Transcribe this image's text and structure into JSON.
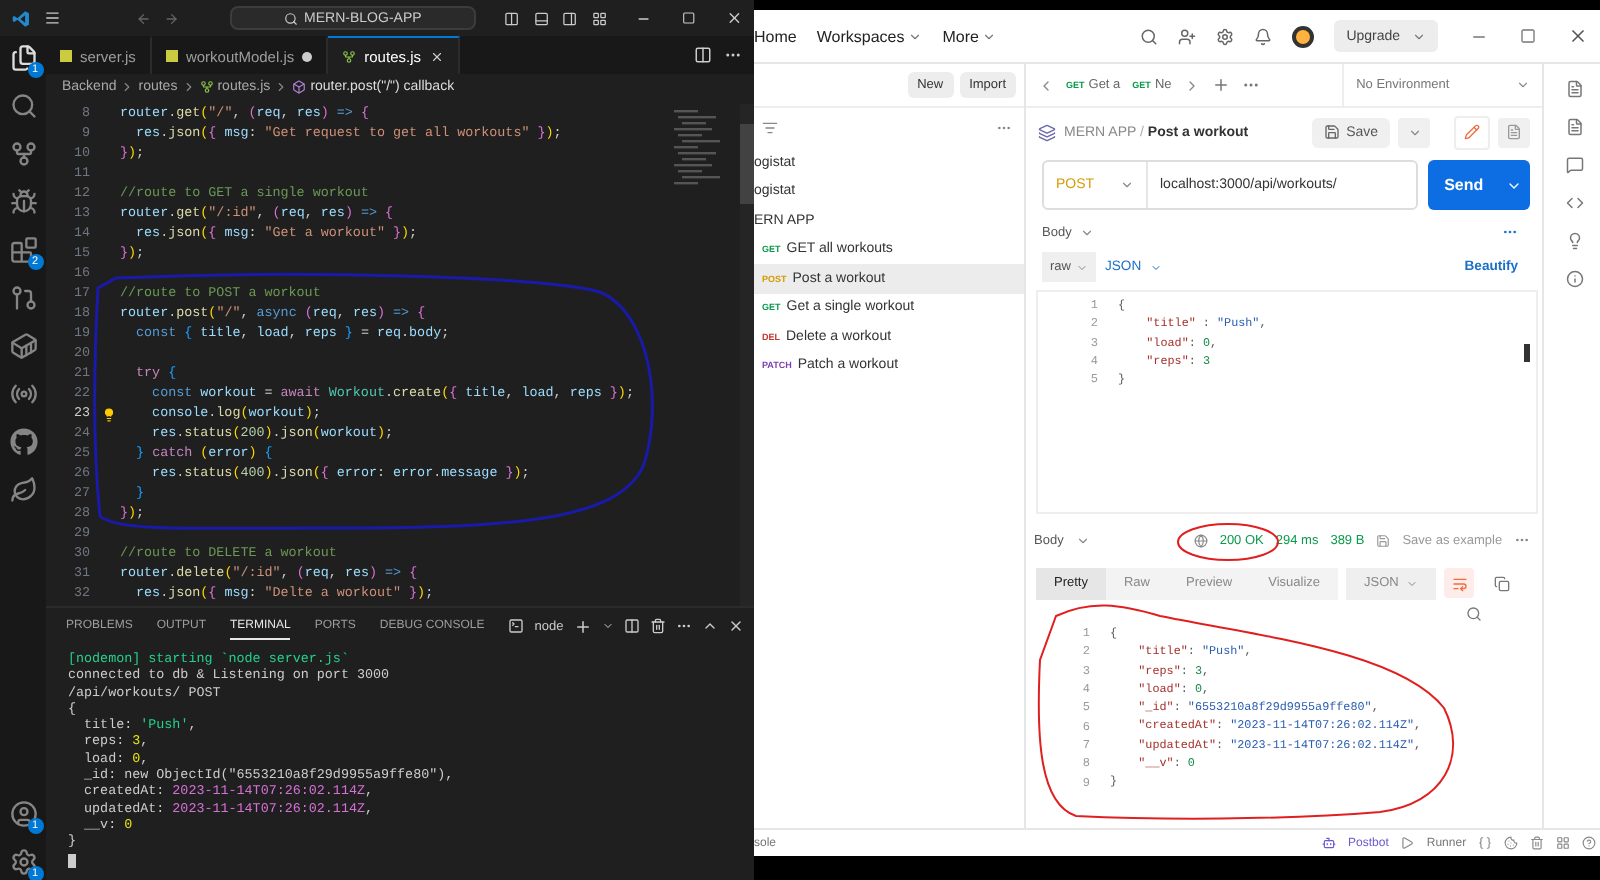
{
  "vscode": {
    "title": "MERN-BLOG-APP",
    "explorer_badge": "1",
    "extensions_badge": "2",
    "accounts_badge": "1",
    "settings_badge": "1",
    "tabs": [
      {
        "label": "server.js",
        "kind": "js",
        "selected": false,
        "modified": false
      },
      {
        "label": "workoutModel.js",
        "kind": "js",
        "selected": false,
        "modified": true
      },
      {
        "label": "routes.js",
        "kind": "route",
        "selected": true,
        "modified": false
      }
    ],
    "breadcrumb": [
      "Backend",
      "routes",
      "routes.js",
      "router.post(\"/\") callback"
    ],
    "code": [
      {
        "n": "8",
        "current": false,
        "tokens": [
          {
            "kind": "v",
            "text": "router"
          },
          {
            "kind": "p",
            "text": "."
          },
          {
            "kind": "f",
            "text": "get"
          },
          {
            "kind": "b1",
            "text": "("
          },
          {
            "kind": "s",
            "text": "\"/\""
          },
          {
            "kind": "p",
            "text": ", "
          },
          {
            "kind": "b2",
            "text": "("
          },
          {
            "kind": "v",
            "text": "req"
          },
          {
            "kind": "p",
            "text": ", "
          },
          {
            "kind": "v",
            "text": "res"
          },
          {
            "kind": "b2",
            "text": ") "
          },
          {
            "kind": "k",
            "text": "=> "
          },
          {
            "kind": "b2",
            "text": "{"
          }
        ]
      },
      {
        "n": "9",
        "current": false,
        "tokens": [
          {
            "kind": "v",
            "text": "  res"
          },
          {
            "kind": "p",
            "text": "."
          },
          {
            "kind": "f",
            "text": "json"
          },
          {
            "kind": "b1",
            "text": "("
          },
          {
            "kind": "b2",
            "text": "{ "
          },
          {
            "kind": "v",
            "text": "msg"
          },
          {
            "kind": "p",
            "text": ": "
          },
          {
            "kind": "s",
            "text": "\"Get request to get all workouts\""
          },
          {
            "kind": "b2",
            "text": " }"
          },
          {
            "kind": "b1",
            "text": ")"
          },
          {
            "kind": "p",
            "text": ";"
          }
        ]
      },
      {
        "n": "10",
        "current": false,
        "tokens": [
          {
            "kind": "b2",
            "text": "}"
          },
          {
            "kind": "b1",
            "text": ")"
          },
          {
            "kind": "p",
            "text": ";"
          }
        ]
      },
      {
        "n": "11",
        "current": false
      },
      {
        "n": "12",
        "current": false,
        "tokens": [
          {
            "kind": "c",
            "text": "//route to GET a single workout"
          }
        ]
      },
      {
        "n": "13",
        "current": false,
        "tokens": [
          {
            "kind": "v",
            "text": "router"
          },
          {
            "kind": "p",
            "text": "."
          },
          {
            "kind": "f",
            "text": "get"
          },
          {
            "kind": "b1",
            "text": "("
          },
          {
            "kind": "s",
            "text": "\"/:id\""
          },
          {
            "kind": "p",
            "text": ", "
          },
          {
            "kind": "b2",
            "text": "("
          },
          {
            "kind": "v",
            "text": "req"
          },
          {
            "kind": "p",
            "text": ", "
          },
          {
            "kind": "v",
            "text": "res"
          },
          {
            "kind": "b2",
            "text": ") "
          },
          {
            "kind": "k",
            "text": "=> "
          },
          {
            "kind": "b2",
            "text": "{"
          }
        ]
      },
      {
        "n": "14",
        "current": false,
        "tokens": [
          {
            "kind": "v",
            "text": "  res"
          },
          {
            "kind": "p",
            "text": "."
          },
          {
            "kind": "f",
            "text": "json"
          },
          {
            "kind": "b1",
            "text": "("
          },
          {
            "kind": "b2",
            "text": "{ "
          },
          {
            "kind": "v",
            "text": "msg"
          },
          {
            "kind": "p",
            "text": ": "
          },
          {
            "kind": "s",
            "text": "\"Get a workout\""
          },
          {
            "kind": "b2",
            "text": " }"
          },
          {
            "kind": "b1",
            "text": ")"
          },
          {
            "kind": "p",
            "text": ";"
          }
        ]
      },
      {
        "n": "15",
        "current": false,
        "tokens": [
          {
            "kind": "b2",
            "text": "}"
          },
          {
            "kind": "b1",
            "text": ")"
          },
          {
            "kind": "p",
            "text": ";"
          }
        ]
      },
      {
        "n": "16",
        "current": false
      },
      {
        "n": "17",
        "current": false,
        "tokens": [
          {
            "kind": "c",
            "text": "//route to POST a workout"
          }
        ]
      },
      {
        "n": "18",
        "current": false,
        "tokens": [
          {
            "kind": "v",
            "text": "router"
          },
          {
            "kind": "p",
            "text": "."
          },
          {
            "kind": "f",
            "text": "post"
          },
          {
            "kind": "b1",
            "text": "("
          },
          {
            "kind": "s",
            "text": "\"/\""
          },
          {
            "kind": "p",
            "text": ", "
          },
          {
            "kind": "k",
            "text": "async "
          },
          {
            "kind": "b2",
            "text": "("
          },
          {
            "kind": "v",
            "text": "req"
          },
          {
            "kind": "p",
            "text": ", "
          },
          {
            "kind": "v",
            "text": "res"
          },
          {
            "kind": "b2",
            "text": ") "
          },
          {
            "kind": "k",
            "text": "=> "
          },
          {
            "kind": "b2",
            "text": "{"
          }
        ]
      },
      {
        "n": "19",
        "current": false,
        "tokens": [
          {
            "kind": "k",
            "text": "  const "
          },
          {
            "kind": "b3",
            "text": "{ "
          },
          {
            "kind": "v",
            "text": "title"
          },
          {
            "kind": "p",
            "text": ", "
          },
          {
            "kind": "v",
            "text": "load"
          },
          {
            "kind": "p",
            "text": ", "
          },
          {
            "kind": "v",
            "text": "reps"
          },
          {
            "kind": "b3",
            "text": " }"
          },
          {
            "kind": "p",
            "text": " = "
          },
          {
            "kind": "v",
            "text": "req"
          },
          {
            "kind": "p",
            "text": "."
          },
          {
            "kind": "v",
            "text": "body"
          },
          {
            "kind": "p",
            "text": ";"
          }
        ]
      },
      {
        "n": "20",
        "current": false
      },
      {
        "n": "21",
        "current": false,
        "tokens": [
          {
            "kind": "m",
            "text": "  try "
          },
          {
            "kind": "b3",
            "text": "{"
          }
        ]
      },
      {
        "n": "22",
        "current": false,
        "tokens": [
          {
            "kind": "k",
            "text": "    const "
          },
          {
            "kind": "v",
            "text": "workout"
          },
          {
            "kind": "p",
            "text": " = "
          },
          {
            "kind": "m",
            "text": "await "
          },
          {
            "kind": "t",
            "text": "Workout"
          },
          {
            "kind": "p",
            "text": "."
          },
          {
            "kind": "f",
            "text": "create"
          },
          {
            "kind": "b1",
            "text": "("
          },
          {
            "kind": "b2",
            "text": "{ "
          },
          {
            "kind": "v",
            "text": "title"
          },
          {
            "kind": "p",
            "text": ", "
          },
          {
            "kind": "v",
            "text": "load"
          },
          {
            "kind": "p",
            "text": ", "
          },
          {
            "kind": "v",
            "text": "reps"
          },
          {
            "kind": "b2",
            "text": " }"
          },
          {
            "kind": "b1",
            "text": ")"
          },
          {
            "kind": "p",
            "text": ";"
          }
        ]
      },
      {
        "n": "23",
        "current": true,
        "tokens": [
          {
            "kind": "v",
            "text": "    console"
          },
          {
            "kind": "p",
            "text": "."
          },
          {
            "kind": "f",
            "text": "log"
          },
          {
            "kind": "b1",
            "text": "("
          },
          {
            "kind": "v",
            "text": "workout"
          },
          {
            "kind": "b1",
            "text": ")"
          },
          {
            "kind": "p",
            "text": ";"
          }
        ]
      },
      {
        "n": "24",
        "current": false,
        "tokens": [
          {
            "kind": "v",
            "text": "    res"
          },
          {
            "kind": "p",
            "text": "."
          },
          {
            "kind": "f",
            "text": "status"
          },
          {
            "kind": "b1",
            "text": "("
          },
          {
            "kind": "n",
            "text": "200"
          },
          {
            "kind": "b1",
            "text": ")"
          },
          {
            "kind": "p",
            "text": "."
          },
          {
            "kind": "f",
            "text": "json"
          },
          {
            "kind": "b1",
            "text": "("
          },
          {
            "kind": "v",
            "text": "workout"
          },
          {
            "kind": "b1",
            "text": ")"
          },
          {
            "kind": "p",
            "text": ";"
          }
        ]
      },
      {
        "n": "25",
        "current": false,
        "tokens": [
          {
            "kind": "b3",
            "text": "  } "
          },
          {
            "kind": "m",
            "text": "catch "
          },
          {
            "kind": "b1",
            "text": "("
          },
          {
            "kind": "v",
            "text": "error"
          },
          {
            "kind": "b1",
            "text": ") "
          },
          {
            "kind": "b3",
            "text": "{"
          }
        ]
      },
      {
        "n": "26",
        "current": false,
        "tokens": [
          {
            "kind": "v",
            "text": "    res"
          },
          {
            "kind": "p",
            "text": "."
          },
          {
            "kind": "f",
            "text": "status"
          },
          {
            "kind": "b1",
            "text": "("
          },
          {
            "kind": "n",
            "text": "400"
          },
          {
            "kind": "b1",
            "text": ")"
          },
          {
            "kind": "p",
            "text": "."
          },
          {
            "kind": "f",
            "text": "json"
          },
          {
            "kind": "b1",
            "text": "("
          },
          {
            "kind": "b2",
            "text": "{ "
          },
          {
            "kind": "v",
            "text": "error"
          },
          {
            "kind": "p",
            "text": ": "
          },
          {
            "kind": "v",
            "text": "error"
          },
          {
            "kind": "p",
            "text": "."
          },
          {
            "kind": "v",
            "text": "message"
          },
          {
            "kind": "b2",
            "text": " }"
          },
          {
            "kind": "b1",
            "text": ")"
          },
          {
            "kind": "p",
            "text": ";"
          }
        ]
      },
      {
        "n": "27",
        "current": false,
        "tokens": [
          {
            "kind": "b3",
            "text": "  }"
          }
        ]
      },
      {
        "n": "28",
        "current": false,
        "tokens": [
          {
            "kind": "b2",
            "text": "}"
          },
          {
            "kind": "b1",
            "text": ")"
          },
          {
            "kind": "p",
            "text": ";"
          }
        ]
      },
      {
        "n": "29",
        "current": false
      },
      {
        "n": "30",
        "current": false,
        "tokens": [
          {
            "kind": "c",
            "text": "//route to DELETE a workout"
          }
        ]
      },
      {
        "n": "31",
        "current": false,
        "tokens": [
          {
            "kind": "v",
            "text": "router"
          },
          {
            "kind": "p",
            "text": "."
          },
          {
            "kind": "f",
            "text": "delete"
          },
          {
            "kind": "b1",
            "text": "("
          },
          {
            "kind": "s",
            "text": "\"/:id\""
          },
          {
            "kind": "p",
            "text": ", "
          },
          {
            "kind": "b2",
            "text": "("
          },
          {
            "kind": "v",
            "text": "req"
          },
          {
            "kind": "p",
            "text": ", "
          },
          {
            "kind": "v",
            "text": "res"
          },
          {
            "kind": "b2",
            "text": ") "
          },
          {
            "kind": "k",
            "text": "=> "
          },
          {
            "kind": "b2",
            "text": "{"
          }
        ]
      },
      {
        "n": "32",
        "current": false,
        "tokens": [
          {
            "kind": "v",
            "text": "  res"
          },
          {
            "kind": "p",
            "text": "."
          },
          {
            "kind": "f",
            "text": "json"
          },
          {
            "kind": "b1",
            "text": "("
          },
          {
            "kind": "b2",
            "text": "{ "
          },
          {
            "kind": "v",
            "text": "msg"
          },
          {
            "kind": "p",
            "text": ": "
          },
          {
            "kind": "s",
            "text": "\"Delte a workout\""
          },
          {
            "kind": "b2",
            "text": " }"
          },
          {
            "kind": "b1",
            "text": ")"
          },
          {
            "kind": "p",
            "text": ";"
          }
        ]
      }
    ],
    "panel_tabs": [
      {
        "label": "PROBLEMS",
        "selected": false
      },
      {
        "label": "OUTPUT",
        "selected": false
      },
      {
        "label": "TERMINAL",
        "selected": true
      },
      {
        "label": "PORTS",
        "selected": false
      },
      {
        "label": "DEBUG CONSOLE",
        "selected": false
      }
    ],
    "terminal_name": "node",
    "terminal": [
      [
        {
          "kind": "g",
          "text": "[nodemon] starting `node server.js`"
        }
      ],
      [
        {
          "kind": "p",
          "text": "connected to db & Listening on port 3000"
        }
      ],
      [
        {
          "kind": "p",
          "text": "/api/workouts/ POST"
        }
      ],
      [
        {
          "kind": "p",
          "text": "{"
        }
      ],
      [
        {
          "kind": "p",
          "text": "  title: "
        },
        {
          "kind": "g",
          "text": "'Push'"
        },
        {
          "kind": "p",
          "text": ","
        }
      ],
      [
        {
          "kind": "p",
          "text": "  reps: "
        },
        {
          "kind": "y",
          "text": "3"
        },
        {
          "kind": "p",
          "text": ","
        }
      ],
      [
        {
          "kind": "p",
          "text": "  load: "
        },
        {
          "kind": "y",
          "text": "0"
        },
        {
          "kind": "p",
          "text": ","
        }
      ],
      [
        {
          "kind": "p",
          "text": "  _id: new ObjectId(\"6553210a8f29d9955a9ffe80\"),"
        }
      ],
      [
        {
          "kind": "p",
          "text": "  createdAt: "
        },
        {
          "kind": "u",
          "text": "2023-11-14T07:26:02.114Z"
        },
        {
          "kind": "p",
          "text": ","
        }
      ],
      [
        {
          "kind": "p",
          "text": "  updatedAt: "
        },
        {
          "kind": "u",
          "text": "2023-11-14T07:26:02.114Z"
        },
        {
          "kind": "p",
          "text": ","
        }
      ],
      [
        {
          "kind": "p",
          "text": "  __v: "
        },
        {
          "kind": "y",
          "text": "0"
        }
      ],
      [
        {
          "kind": "p",
          "text": "}"
        }
      ]
    ]
  },
  "postman": {
    "nav": [
      {
        "label": "Home",
        "menu": false
      },
      {
        "label": "Workspaces",
        "menu": true
      },
      {
        "label": "More",
        "menu": true
      }
    ],
    "upgrade": "Upgrade",
    "new": "New",
    "import": "Import",
    "collections": [
      {
        "name": "ogistat"
      },
      {
        "name": "ogistat"
      },
      {
        "name": "ERN APP",
        "children": [
          {
            "kind": "get",
            "method": "GET",
            "name": "GET all workouts",
            "selected": false
          },
          {
            "kind": "post",
            "method": "POST",
            "name": "Post a workout",
            "selected": true
          },
          {
            "kind": "get",
            "method": "GET",
            "name": "Get a single workout",
            "selected": false
          },
          {
            "kind": "delete",
            "method": "DEL",
            "name": "Delete a workout",
            "selected": false
          },
          {
            "kind": "patch",
            "method": "PATCH",
            "name": "Patch a workout",
            "selected": false
          }
        ]
      }
    ],
    "request_tabs": [
      {
        "kind": "get",
        "method": "GET",
        "label": "Get a"
      },
      {
        "kind": "get",
        "method": "GET",
        "label": "Ne"
      }
    ],
    "environment": "No Environment",
    "collection": "MERN APP",
    "crumb_separator": "/",
    "request_name": "Post a workout",
    "save": "Save",
    "method": {
      "kind": "post",
      "label": "POST"
    },
    "url": "localhost:3000/api/workouts/",
    "send": "Send",
    "body_label": "Body",
    "body_mode": "raw",
    "body_format": "JSON",
    "beautify": "Beautify",
    "request_body": [
      {
        "n": "1",
        "tokens": [
          {
            "kind": "p",
            "text": "{"
          }
        ]
      },
      {
        "n": "2",
        "tokens": [
          {
            "kind": "key",
            "text": "    \"title\""
          },
          {
            "kind": "p",
            "text": " : "
          },
          {
            "kind": "str",
            "text": "\"Push\""
          },
          {
            "kind": "p",
            "text": ","
          }
        ]
      },
      {
        "n": "3",
        "tokens": [
          {
            "kind": "key",
            "text": "    \"load\""
          },
          {
            "kind": "p",
            "text": ": "
          },
          {
            "kind": "num",
            "text": "0"
          },
          {
            "kind": "p",
            "text": ","
          }
        ]
      },
      {
        "n": "4",
        "tokens": [
          {
            "kind": "key",
            "text": "    \"reps\""
          },
          {
            "kind": "p",
            "text": ": "
          },
          {
            "kind": "num",
            "text": "3"
          }
        ]
      },
      {
        "n": "5",
        "tokens": [
          {
            "kind": "p",
            "text": "}"
          }
        ]
      }
    ],
    "response": {
      "body_label": "Body",
      "status": "200 OK",
      "time": "294 ms",
      "size": "389 B",
      "save_example": "Save as example",
      "tabs": [
        {
          "label": "Pretty",
          "selected": true
        },
        {
          "label": "Raw",
          "selected": false
        },
        {
          "label": "Preview",
          "selected": false
        },
        {
          "label": "Visualize",
          "selected": false
        }
      ],
      "format": "JSON",
      "lines": [
        {
          "n": "1",
          "tokens": [
            {
              "kind": "p",
              "text": "{"
            }
          ]
        },
        {
          "n": "2",
          "tokens": [
            {
              "kind": "key",
              "text": "    \"title\""
            },
            {
              "kind": "p",
              "text": ": "
            },
            {
              "kind": "str",
              "text": "\"Push\""
            },
            {
              "kind": "p",
              "text": ","
            }
          ]
        },
        {
          "n": "3",
          "tokens": [
            {
              "kind": "key",
              "text": "    \"reps\""
            },
            {
              "kind": "p",
              "text": ": "
            },
            {
              "kind": "num",
              "text": "3"
            },
            {
              "kind": "p",
              "text": ","
            }
          ]
        },
        {
          "n": "4",
          "tokens": [
            {
              "kind": "key",
              "text": "    \"load\""
            },
            {
              "kind": "p",
              "text": ": "
            },
            {
              "kind": "num",
              "text": "0"
            },
            {
              "kind": "p",
              "text": ","
            }
          ]
        },
        {
          "n": "5",
          "tokens": [
            {
              "kind": "key",
              "text": "    \"_id\""
            },
            {
              "kind": "p",
              "text": ": "
            },
            {
              "kind": "str",
              "text": "\"6553210a8f29d9955a9ffe80\""
            },
            {
              "kind": "p",
              "text": ","
            }
          ]
        },
        {
          "n": "6",
          "tokens": [
            {
              "kind": "key",
              "text": "    \"createdAt\""
            },
            {
              "kind": "p",
              "text": ": "
            },
            {
              "kind": "str",
              "text": "\"2023-11-14T07:26:02.114Z\""
            },
            {
              "kind": "p",
              "text": ","
            }
          ]
        },
        {
          "n": "7",
          "tokens": [
            {
              "kind": "key",
              "text": "    \"updatedAt\""
            },
            {
              "kind": "p",
              "text": ": "
            },
            {
              "kind": "str",
              "text": "\"2023-11-14T07:26:02.114Z\""
            },
            {
              "kind": "p",
              "text": ","
            }
          ]
        },
        {
          "n": "8",
          "tokens": [
            {
              "kind": "key",
              "text": "    \"__v\""
            },
            {
              "kind": "p",
              "text": ": "
            },
            {
              "kind": "num",
              "text": "0"
            }
          ]
        },
        {
          "n": "9",
          "tokens": [
            {
              "kind": "p",
              "text": "}"
            }
          ]
        }
      ]
    },
    "status_left": "sole",
    "postbot": "Postbot",
    "runner": "Runner"
  }
}
